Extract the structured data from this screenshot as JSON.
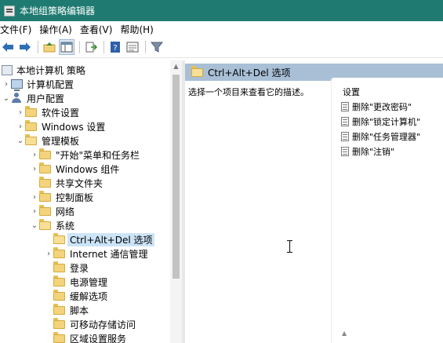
{
  "window": {
    "title": "本地组策略编辑器"
  },
  "menu": [
    {
      "label": "文件(F)"
    },
    {
      "label": "操作(A)"
    },
    {
      "label": "查看(V)"
    },
    {
      "label": "帮助(H)"
    }
  ],
  "toolbar": {
    "icons": [
      "back-arrow",
      "forward-arrow",
      "up-folder",
      "show-hide-tree",
      "export-list",
      "help",
      "properties-view",
      "filter"
    ]
  },
  "tree": {
    "root": "本地计算机 策略",
    "items": [
      {
        "label": "计算机配置"
      },
      {
        "label": "用户配置"
      },
      {
        "label": "软件设置"
      },
      {
        "label": "Windows 设置"
      },
      {
        "label": "管理模板"
      },
      {
        "label": "\"开始\"菜单和任务栏"
      },
      {
        "label": "Windows 组件"
      },
      {
        "label": "共享文件夹"
      },
      {
        "label": "控制面板"
      },
      {
        "label": "网络"
      },
      {
        "label": "系统"
      },
      {
        "label": "Ctrl+Alt+Del 选项"
      },
      {
        "label": "Internet 通信管理"
      },
      {
        "label": "登录"
      },
      {
        "label": "电源管理"
      },
      {
        "label": "缓解选项"
      },
      {
        "label": "脚本"
      },
      {
        "label": "可移动存储访问"
      },
      {
        "label": "区域设置服务"
      }
    ]
  },
  "detail": {
    "header": "Ctrl+Alt+Del 选项",
    "description": "选择一个项目来查看它的描述。",
    "settings_title": "设置",
    "settings": [
      {
        "label": "删除\"更改密码\""
      },
      {
        "label": "删除\"锁定计算机\""
      },
      {
        "label": "删除\"任务管理器\""
      },
      {
        "label": "删除\"注销\""
      }
    ]
  },
  "colors": {
    "titlebar": "#1f7a72",
    "detail_header": "#a9bfd6",
    "selection": "#cce4f7",
    "folder": "#f3d37c"
  }
}
